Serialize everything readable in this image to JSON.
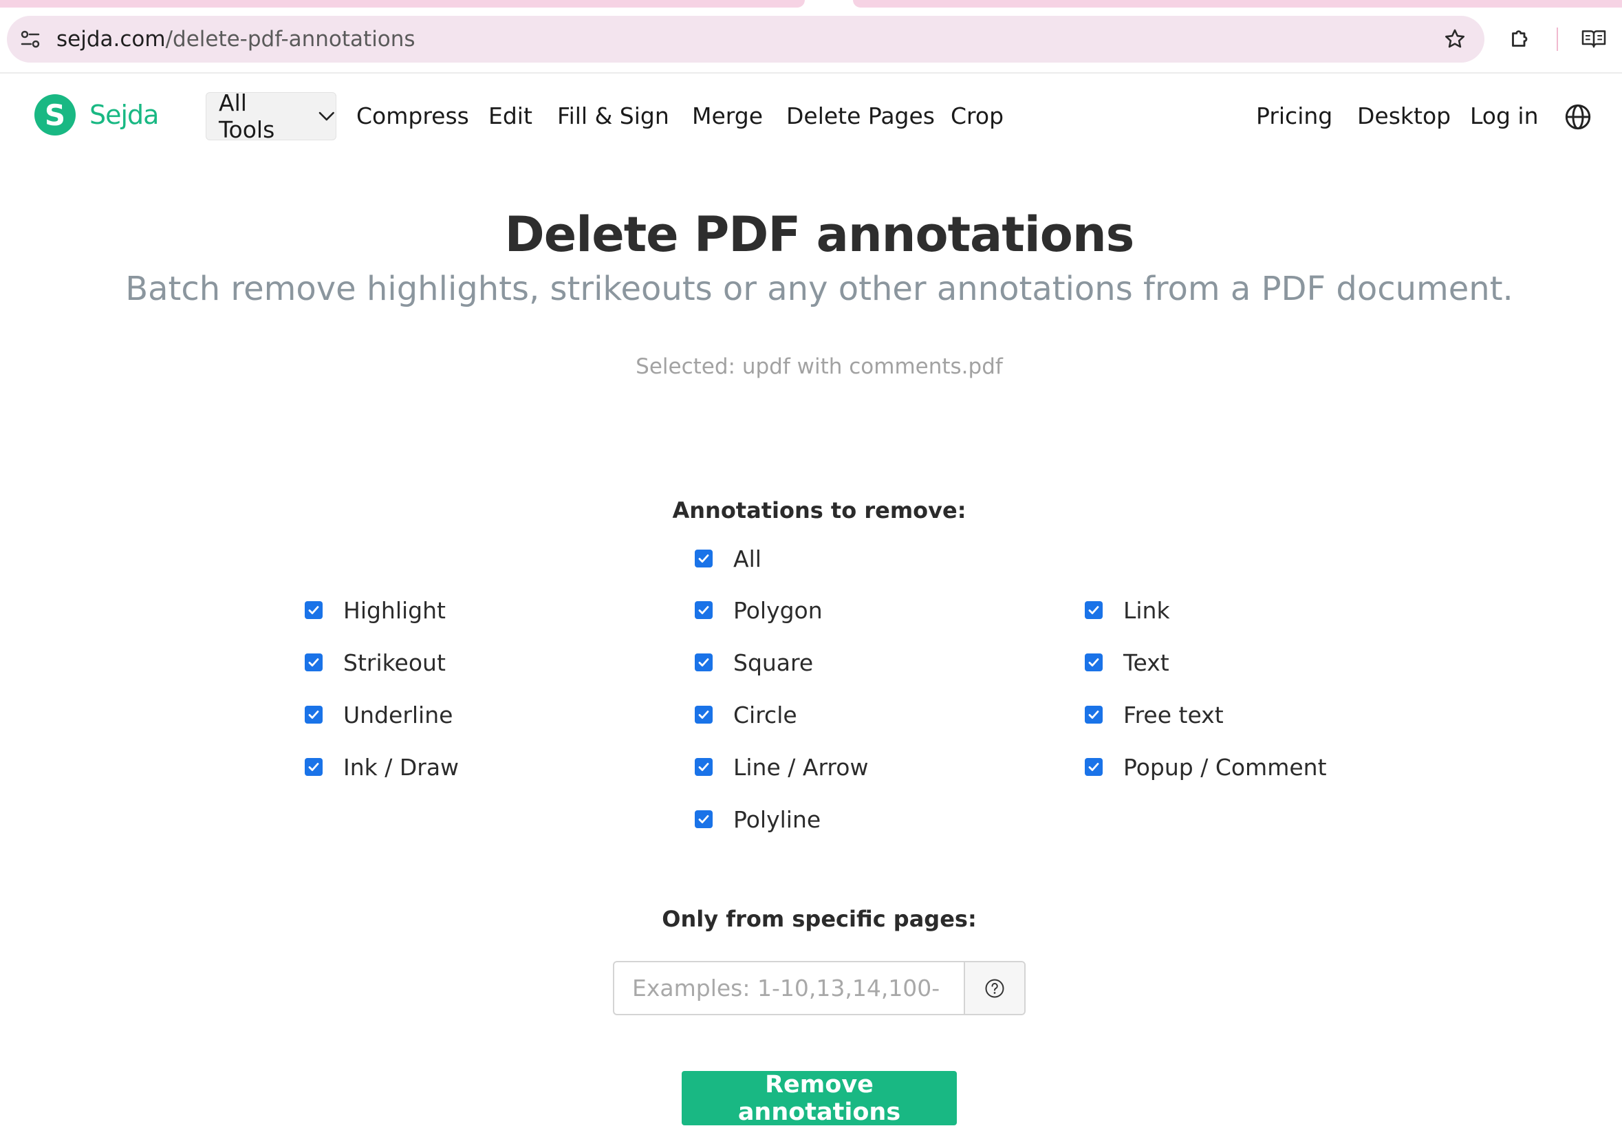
{
  "browser": {
    "url_host": "sejda.com",
    "url_path": "/delete-pdf-annotations"
  },
  "header": {
    "logo_text": "Sejda",
    "logo_letter": "S",
    "all_tools": "All Tools",
    "nav": [
      "Compress",
      "Edit",
      "Fill & Sign",
      "Merge",
      "Delete Pages",
      "Crop"
    ],
    "right_nav": [
      "Pricing",
      "Desktop",
      "Log in"
    ]
  },
  "main": {
    "title": "Delete PDF annotations",
    "subtitle": "Batch remove highlights, strikeouts or any other annotations from a PDF document.",
    "selected_file": "Selected: updf with comments.pdf",
    "annotations_label": "Annotations to remove:",
    "all_option": "All",
    "columns": [
      [
        "Highlight",
        "Strikeout",
        "Underline",
        "Ink / Draw"
      ],
      [
        "Polygon",
        "Square",
        "Circle",
        "Line / Arrow",
        "Polyline"
      ],
      [
        "Link",
        "Text",
        "Free text",
        "Popup / Comment"
      ]
    ],
    "pages_label": "Only from specific pages:",
    "pages_placeholder": "Examples: 1-10,13,14,100-",
    "pages_value": "",
    "submit_label": "Remove annotations"
  },
  "colors": {
    "brand": "#19b883",
    "checkbox": "#1a73e8"
  }
}
